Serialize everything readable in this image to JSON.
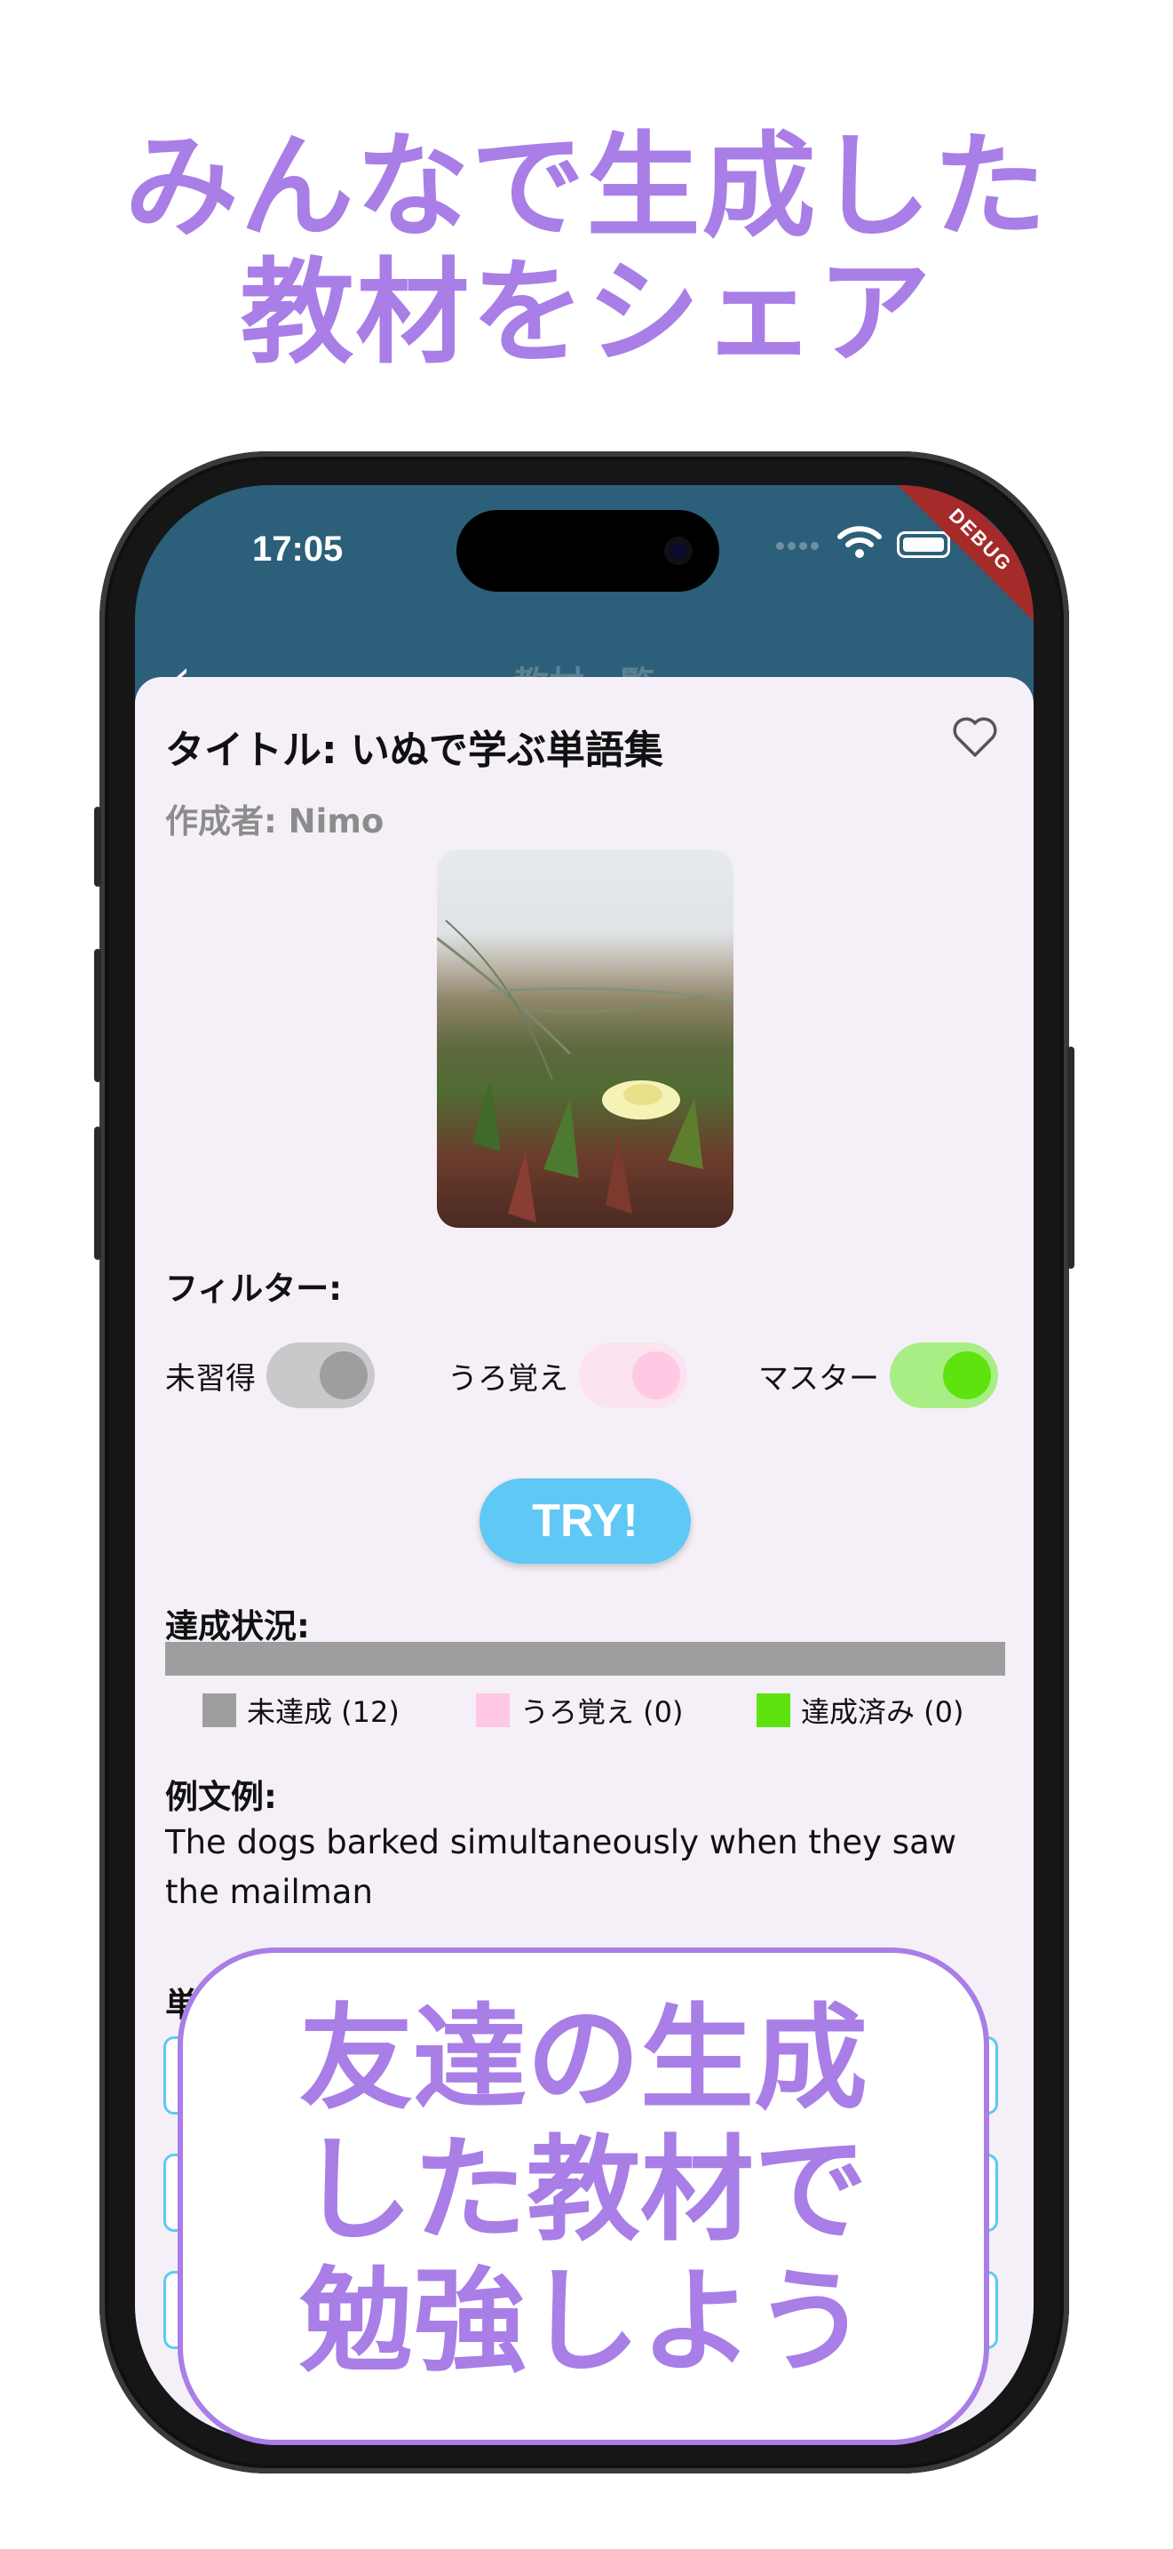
{
  "promo": {
    "headline_line1": "みんなで生成した",
    "headline_line2": "教材をシェア",
    "callout_line1": "友達の生成",
    "callout_line2": "した教材で",
    "callout_line3": "勉強しよう",
    "accent_color": "#a97ee6"
  },
  "status_bar": {
    "time": "17:05",
    "debug_banner": "DEBUG"
  },
  "nav": {
    "back_icon": "chevron-left-icon",
    "title": "教材一覧"
  },
  "material": {
    "title": "タイトル: いぬで学ぶ単語集",
    "author": "作成者: Nimo",
    "favorite_icon": "heart-outline-icon",
    "image_alt": "flower photo"
  },
  "filter": {
    "label": "フィルター:",
    "items": [
      {
        "label": "未習得",
        "on": true,
        "color": "#9e9e9e"
      },
      {
        "label": "うろ覚え",
        "on": true,
        "color": "#ffc8e4"
      },
      {
        "label": "マスター",
        "on": true,
        "color": "#5ee30e"
      }
    ]
  },
  "try_button": {
    "label": "TRY!",
    "color": "#5fc8f4"
  },
  "progress": {
    "label": "達成状況:",
    "unlearned_fraction": 1.0,
    "legend": [
      {
        "label": "未達成 (12)",
        "color": "#9e9e9e"
      },
      {
        "label": "うろ覚え (0)",
        "color": "#ffc8e4"
      },
      {
        "label": "達成済み (0)",
        "color": "#5ee30e"
      }
    ]
  },
  "example": {
    "label": "例文例:",
    "text": "The dogs barked simultaneously when they saw the mailman"
  },
  "words": {
    "label": "単語"
  }
}
